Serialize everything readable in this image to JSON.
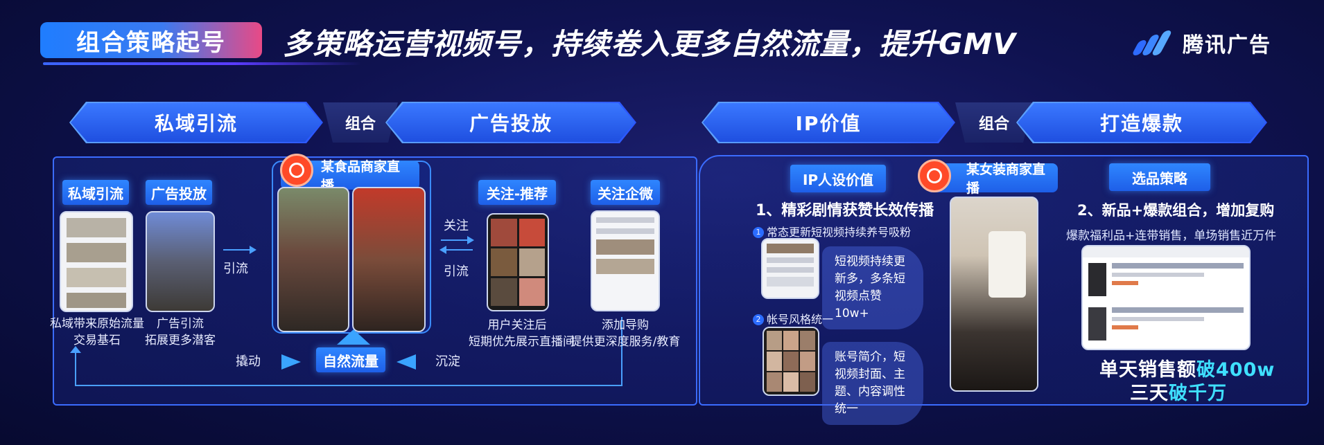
{
  "header": {
    "title_pill": "组合策略起号",
    "headline": "多策略运营视频号，持续卷入更多自然流量，提升GMV",
    "logo_text": "腾讯广告"
  },
  "left_section": {
    "banner_left": "私域引流",
    "combine": "组合",
    "banner_right": "广告投放",
    "private_label": "私域引流",
    "ad_label": "广告投放",
    "private_caption_1": "私域带来原始流量",
    "private_caption_2": "交易基石",
    "ad_caption_1": "广告引流",
    "ad_caption_2": "拓展更多潜客",
    "arrow_label": "引流",
    "live_title": "某食品商家直播",
    "follow_label": "关注",
    "drain_label": "引流",
    "follow_rec_label": "关注-推荐",
    "follow_rec_caption_1": "用户关注后",
    "follow_rec_caption_2": "短期优先展示直播间",
    "wecom_label": "关注企微",
    "wecom_caption_1": "添加导购",
    "wecom_caption_2": "提供更深度服务/教育",
    "leverage_label": "撬动",
    "natural_flow_label": "自然流量",
    "settle_label": "沉淀"
  },
  "right_section": {
    "banner_left": "IP价值",
    "combine": "组合",
    "banner_right": "打造爆款",
    "ip_label": "IP人设价值",
    "ip_heading": "1、精彩剧情获赞长效传播",
    "point1_num": "1",
    "point1": "常态更新短视频持续养号吸粉",
    "bubble1": "短视频持续更新多，多条短视频点赞10w+",
    "point2_num": "2",
    "point2": "帐号风格统一",
    "bubble2": "账号简介，短视频封面、主题、内容调性统一",
    "live_title": "某女装商家直播",
    "product_label": "选品策略",
    "product_heading": "2、新品+爆款组合，增加复购",
    "product_sub": "爆款福利品+连带销售，单场销售近万件",
    "sales_line1_pre": "单天销售额",
    "sales_line1_hi": "破400w",
    "sales_line2_pre": "三天",
    "sales_line2_hi": "破千万"
  },
  "colors": {
    "accent_blue": "#2f86ff",
    "highlight_cyan": "#3fe0ff",
    "record_red": "#ff4a28"
  }
}
